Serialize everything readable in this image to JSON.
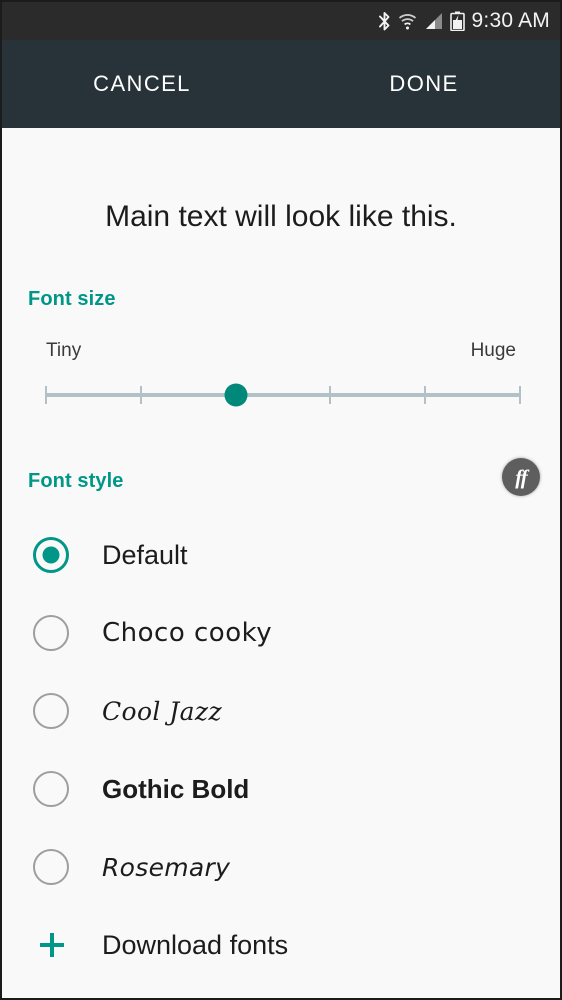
{
  "status_bar": {
    "icons": [
      "bluetooth-icon",
      "wifi-icon",
      "signal-icon",
      "battery-icon"
    ],
    "time": "9:30 AM",
    "background_color": "#2b2b2b"
  },
  "action_bar": {
    "cancel_label": "CANCEL",
    "done_label": "DONE",
    "background_color": "#283339"
  },
  "preview": {
    "text": "Main text will look like this."
  },
  "accent_color": "#009688",
  "font_size": {
    "label": "Font size",
    "min_label": "Tiny",
    "max_label": "Huge",
    "tick_count": 6,
    "value_index": 2
  },
  "font_style": {
    "label": "Font style",
    "flipfont_badge": "ff",
    "options": [
      {
        "label": "Default",
        "selected": true,
        "style_class": "f-default"
      },
      {
        "label": "Choco cooky",
        "selected": false,
        "style_class": "f-choco"
      },
      {
        "label": "Cool Jazz",
        "selected": false,
        "style_class": "f-cooljazz"
      },
      {
        "label": "Gothic Bold",
        "selected": false,
        "style_class": "f-gothic"
      },
      {
        "label": "Rosemary",
        "selected": false,
        "style_class": "f-rosemary"
      }
    ],
    "download_label": "Download fonts",
    "download_icon": "plus-icon"
  }
}
